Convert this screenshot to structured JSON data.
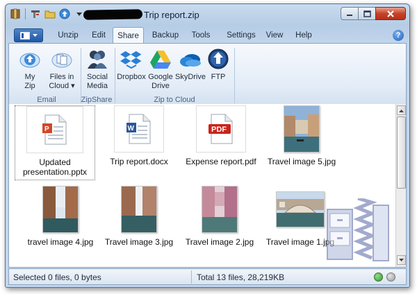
{
  "window": {
    "title": "Trip report.zip",
    "title_prefix_redacted": true
  },
  "tabs": [
    {
      "label": "Unzip"
    },
    {
      "label": "Edit"
    },
    {
      "label": "Share",
      "active": true
    },
    {
      "label": "Backup"
    },
    {
      "label": "Tools"
    },
    {
      "label": "Settings"
    },
    {
      "label": "View"
    },
    {
      "label": "Help"
    }
  ],
  "ribbon": {
    "my_zip": {
      "line1": "My",
      "line2": "Zip",
      "icon": "upload-cloud-icon"
    },
    "files_in_cloud": {
      "line1": "Files in",
      "line2": "Cloud ▾",
      "icon": "cloud-files-icon"
    },
    "social_media": {
      "line1": "Social",
      "line2": "Media",
      "icon": "people-icon"
    },
    "dropbox": {
      "line1": "Dropbox",
      "icon": "dropbox-icon"
    },
    "google_drive": {
      "line1": "Google",
      "line2": "Drive",
      "icon": "google-drive-icon"
    },
    "skydrive": {
      "line1": "SkyDrive",
      "icon": "skydrive-icon"
    },
    "ftp": {
      "line1": "FTP",
      "icon": "ftp-icon"
    },
    "groups": {
      "email": "Email",
      "zipshare": "ZipShare",
      "zip_to_cloud": "Zip to Cloud"
    }
  },
  "files": [
    {
      "name_line1": "Updated",
      "name_line2": "presentation.pptx",
      "type": "pptx",
      "selected": true
    },
    {
      "name": "Trip report.docx",
      "type": "docx"
    },
    {
      "name": "Expense report.pdf",
      "type": "pdf"
    },
    {
      "name": "Travel image 5.jpg",
      "type": "jpg"
    },
    {
      "name": "travel image 4.jpg",
      "type": "jpg"
    },
    {
      "name": "Travel image 3.jpg",
      "type": "jpg"
    },
    {
      "name": "Travel image 2.jpg",
      "type": "jpg"
    },
    {
      "name": "Travel image 1.jpg",
      "type": "jpg"
    }
  ],
  "status": {
    "selection": "Selected 0 files, 0 bytes",
    "total": "Total 13 files, 28,219KB",
    "indicator_colors": [
      "#39b54a",
      "#a8a8a8"
    ]
  },
  "colors": {
    "accent": "#1f57a5",
    "pdf_red": "#c8251c",
    "word_blue": "#2b5797"
  }
}
